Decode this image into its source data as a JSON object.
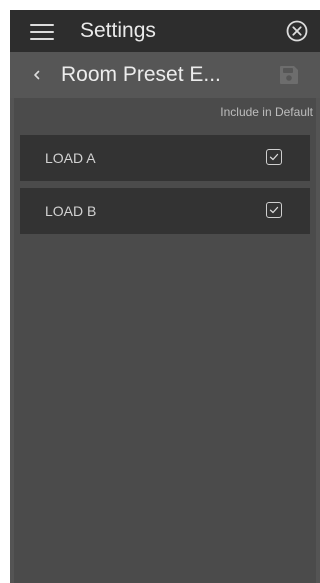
{
  "header": {
    "title": "Settings",
    "menu_icon": "hamburger-menu-icon",
    "close_icon": "close-circle-icon"
  },
  "subheader": {
    "title": "Room Preset E...",
    "back_icon": "chevron-left-icon",
    "save_icon": "save-disk-icon"
  },
  "list": {
    "column_header": "Include in Default",
    "items": [
      {
        "label": "LOAD A",
        "checked": true
      },
      {
        "label": "LOAD B",
        "checked": true
      }
    ]
  },
  "colors": {
    "header_bg": "#2d2d2d",
    "subheader_bg": "#565656",
    "panel_bg": "#4b4b4b",
    "row_bg": "#333333"
  }
}
